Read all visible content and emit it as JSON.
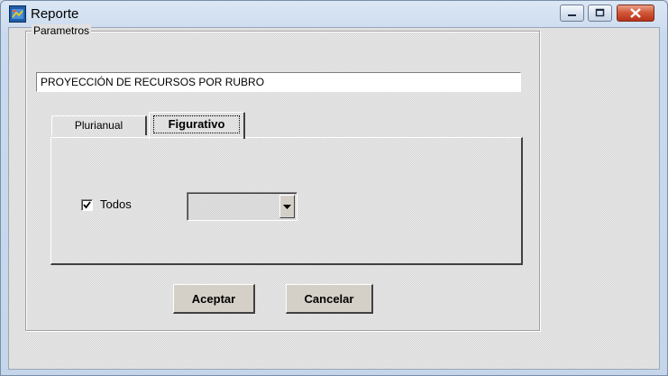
{
  "window": {
    "title": "Reporte",
    "controls": [
      "minimize-icon",
      "maximize-icon",
      "close-icon"
    ]
  },
  "form": {
    "group_label": "Parametros",
    "report_name": "PROYECCIÓN DE RECURSOS POR RUBRO",
    "tabs": [
      {
        "label": "Plurianual",
        "active": false
      },
      {
        "label": "Figurativo",
        "active": true
      }
    ],
    "todos": {
      "label": "Todos",
      "checked": true
    },
    "select": {
      "value": ""
    },
    "buttons": {
      "accept": "Aceptar",
      "cancel": "Cancelar"
    }
  },
  "colors": {
    "titlebar": "#c9d9ee",
    "close_button": "#d25a3a",
    "dialog_face": "#e1e1e1"
  }
}
